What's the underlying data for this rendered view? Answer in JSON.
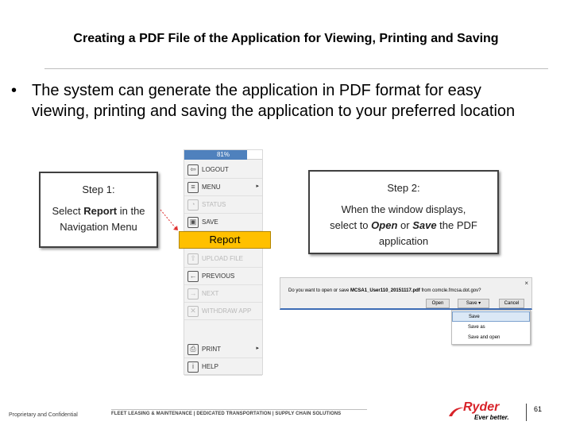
{
  "slide": {
    "title": "Creating a PDF File of the Application for Viewing, Printing and Saving",
    "bullet_char": "•",
    "bullet_text": "The system can generate the application in PDF format for easy viewing, printing and saving the application to your preferred location"
  },
  "nav_menu": {
    "progress_text": "81%",
    "progress_fraction": 0.81,
    "progress_color": "#4f81bd",
    "items": [
      {
        "label": "LOGOUT",
        "icon": "logout-icon",
        "glyph": "⇦",
        "disabled": false,
        "submenu": false
      },
      {
        "label": "MENU",
        "icon": "menu-icon",
        "glyph": "≡",
        "disabled": false,
        "submenu": true
      },
      {
        "label": "STATUS",
        "icon": "status-icon",
        "glyph": "◔",
        "disabled": true,
        "submenu": false
      },
      {
        "label": "SAVE",
        "icon": "save-icon",
        "glyph": "▣",
        "disabled": false,
        "submenu": false
      },
      {
        "label": "UPLOAD FILE",
        "icon": "upload-icon",
        "glyph": "⇧",
        "disabled": true,
        "submenu": false
      },
      {
        "label": "PREVIOUS",
        "icon": "previous-icon",
        "glyph": "←",
        "disabled": false,
        "submenu": false
      },
      {
        "label": "NEXT",
        "icon": "next-icon",
        "glyph": "→",
        "disabled": true,
        "submenu": false
      },
      {
        "label": "WITHDRAW APP",
        "icon": "withdraw-icon",
        "glyph": "✕",
        "disabled": true,
        "submenu": false
      },
      {
        "label": "PRINT",
        "icon": "print-icon",
        "glyph": "⎙",
        "disabled": false,
        "submenu": true
      },
      {
        "label": "HELP",
        "icon": "help-icon",
        "glyph": "i",
        "disabled": false,
        "submenu": false
      }
    ],
    "highlight_label": "Report",
    "highlight_color": "#ffc000"
  },
  "step1": {
    "title": "Step 1:",
    "line1_pre": "Select ",
    "line1_em": "Report",
    "line1_post": " in the",
    "line2": "Navigation Menu"
  },
  "step2": {
    "title": "Step 2:",
    "line1": "When the window displays,",
    "line2_pre": "select to ",
    "line2_em1": "Open",
    "line2_mid": " or ",
    "line2_em2": "Save",
    "line2_post": " the PDF",
    "line3": "application"
  },
  "download_bar": {
    "question_pre": "Do you want to open or save ",
    "filename": "MCSA1_User110_20151117.pdf",
    "question_post": " from comcle.fmcsa.dot.gov?",
    "close_glyph": "×",
    "open_label": "Open",
    "save_label": "Save",
    "save_dropdown_glyph": "▾",
    "cancel_label": "Cancel",
    "menu_items": [
      "Save",
      "Save as",
      "Save and open"
    ]
  },
  "footer": {
    "confidential": "Proprietary and Confidential",
    "services": "FLEET LEASING & MAINTENANCE   |   DEDICATED TRANSPORTATION   |   SUPPLY CHAIN SOLUTIONS",
    "brand": "Ryder",
    "tagline": "Ever better.",
    "brand_color": "#d8232a",
    "page_number": "61"
  }
}
